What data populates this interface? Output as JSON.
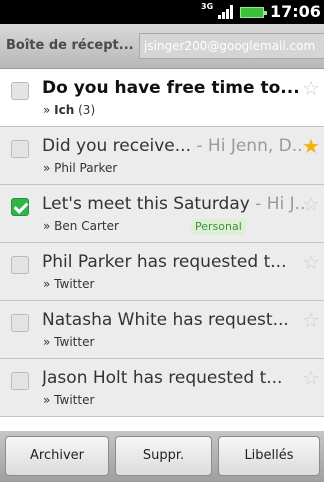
{
  "status_bar": {
    "network": "3G",
    "time": "17:06"
  },
  "header": {
    "folder": "Boîte de récept...",
    "account": "jsinger200@googlemail.com"
  },
  "messages": [
    {
      "subject": "Do you have free time to...",
      "snippet": " -...",
      "from": "Ich",
      "count": "(3)",
      "unread": true,
      "checked": false,
      "starred": false,
      "label": ""
    },
    {
      "subject": "Did you receive...",
      "snippet": " - Hi Jenn, D...",
      "from": "Phil Parker",
      "count": "",
      "unread": false,
      "checked": false,
      "starred": true,
      "label": ""
    },
    {
      "subject": "Let's meet this Saturday",
      "snippet": " - Hi J...",
      "from": "Ben Carter",
      "count": "",
      "unread": false,
      "checked": true,
      "starred": false,
      "label": "Personal"
    },
    {
      "subject": "Phil Parker has requested t...",
      "snippet": "",
      "from": "Twitter",
      "count": "",
      "unread": false,
      "checked": false,
      "starred": false,
      "label": ""
    },
    {
      "subject": "Natasha White has request...",
      "snippet": "",
      "from": "Twitter",
      "count": "",
      "unread": false,
      "checked": false,
      "starred": false,
      "label": ""
    },
    {
      "subject": "Jason Holt has requested t...",
      "snippet": "",
      "from": "Twitter",
      "count": "",
      "unread": false,
      "checked": false,
      "starred": false,
      "label": ""
    }
  ],
  "from_prefix": "»",
  "actions": {
    "archive": "Archiver",
    "delete": "Suppr.",
    "labels": "Libellés"
  },
  "colors": {
    "star_on": "#f2b10b",
    "check_on": "#2fb64a",
    "label_text": "#3e8f3e"
  }
}
